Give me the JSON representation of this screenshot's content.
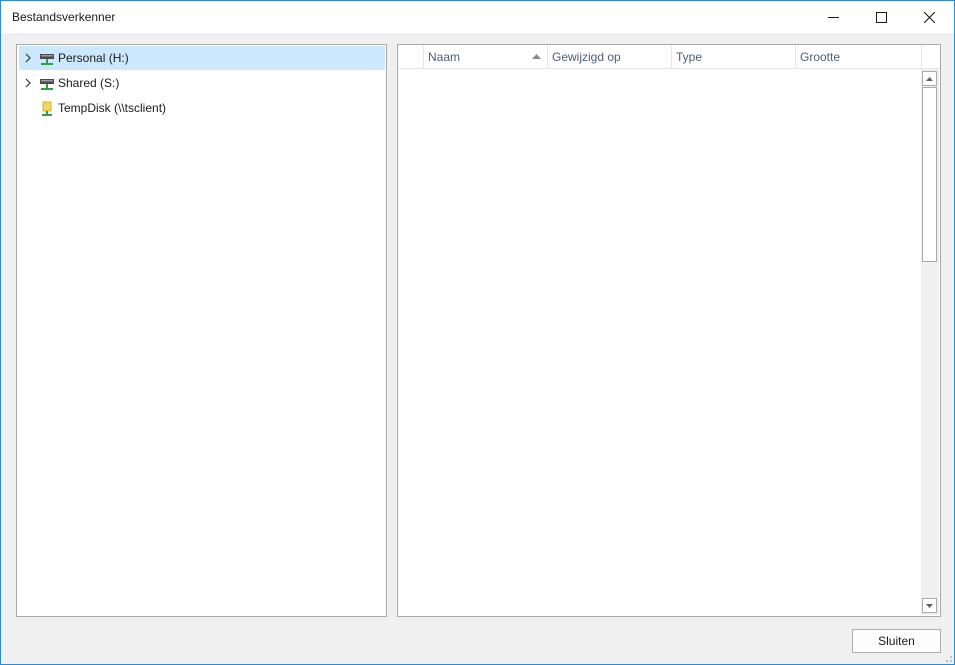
{
  "window": {
    "title": "Bestandsverkenner",
    "controls": {
      "minimize": "minimize-icon",
      "maximize": "maximize-icon",
      "close": "close-icon"
    }
  },
  "tree": {
    "items": [
      {
        "label": "Personal (H:)",
        "icon": "network-drive-icon",
        "expandable": true,
        "selected": true
      },
      {
        "label": "Shared (S:)",
        "icon": "network-drive-icon",
        "expandable": true,
        "selected": false
      },
      {
        "label": "TempDisk (\\\\tsclient)",
        "icon": "redirected-drive-icon",
        "expandable": false,
        "selected": false
      }
    ]
  },
  "file_list": {
    "columns": [
      {
        "label": "Naam",
        "sorted": "ascending"
      },
      {
        "label": "Gewijzigd op"
      },
      {
        "label": "Type"
      },
      {
        "label": "Grootte"
      }
    ],
    "rows": []
  },
  "footer": {
    "close_label": "Sluiten"
  },
  "colors": {
    "accent_border": "#2b8ad6",
    "selection": "#cce8ff",
    "header_text": "#4c607a",
    "drive_green": "#2ea043",
    "folder_yellow": "#f5d55b"
  }
}
